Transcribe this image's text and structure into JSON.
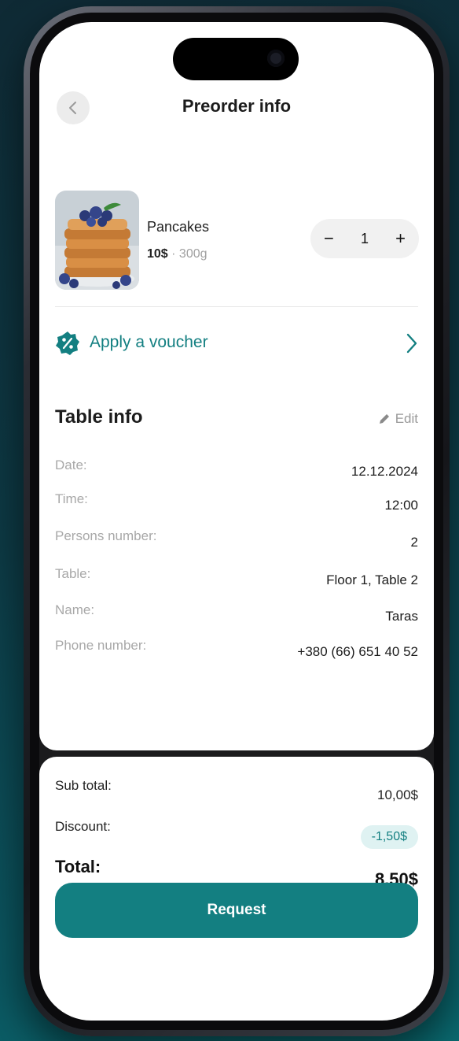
{
  "header": {
    "title": "Preorder info"
  },
  "item": {
    "name": "Pancakes",
    "price": "10$",
    "separator": " · ",
    "weight": "300g",
    "quantity": "1",
    "minus": "−",
    "plus": "+"
  },
  "voucher": {
    "label": "Apply a voucher"
  },
  "table_info": {
    "title": "Table info",
    "edit_label": "Edit",
    "rows": [
      {
        "label": "Date:",
        "value": "12.12.2024"
      },
      {
        "label": "Time:",
        "value": "12:00"
      },
      {
        "label": "Persons number:",
        "value": "2"
      },
      {
        "label": "Table:",
        "value": "Floor 1, Table 2"
      },
      {
        "label": "Name:",
        "value": "Taras"
      },
      {
        "label": "Phone number:",
        "value": "+380 (66) 651 40 52"
      }
    ]
  },
  "summary": {
    "subtotal_label": "Sub total:",
    "subtotal_value": "10,00$",
    "discount_label": "Discount:",
    "discount_value": "-1,50$",
    "total_label": "Total:",
    "total_value": "8,50$"
  },
  "request_button": "Request",
  "colors": {
    "accent": "#137f81",
    "discount_bg": "#dff2f2"
  },
  "icons": {
    "back": "chevron-left-icon",
    "voucher": "percent-badge-icon",
    "voucher_arrow": "chevron-right-icon",
    "edit": "pencil-icon"
  }
}
